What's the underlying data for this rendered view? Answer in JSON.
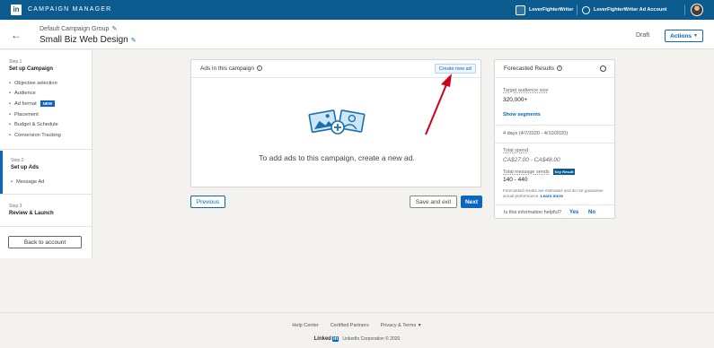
{
  "topbar": {
    "logo_text": "in",
    "app_title": "CAMPAIGN MANAGER",
    "account_name": "LoverFighterWriter",
    "ad_account_name": "LoverFighterWriter Ad Account"
  },
  "header": {
    "group_name": "Default Campaign Group",
    "campaign_name": "Small Biz Web Design",
    "status": "Draft",
    "actions_label": "Actions"
  },
  "sidebar": {
    "step1": {
      "label": "Step 1",
      "title": "Set up Campaign",
      "items": [
        {
          "label": "Objective selection"
        },
        {
          "label": "Audience"
        },
        {
          "label": "Ad format",
          "badge": "NEW"
        },
        {
          "label": "Placement"
        },
        {
          "label": "Budget & Schedule"
        },
        {
          "label": "Conversion Tracking"
        }
      ]
    },
    "step2": {
      "label": "Step 2",
      "title": "Set up Ads",
      "items": [
        {
          "label": "Message Ad"
        }
      ]
    },
    "step3": {
      "label": "Step 3",
      "title": "Review & Launch"
    },
    "back_button": "Back to account"
  },
  "ads_card": {
    "title": "Ads in this campaign",
    "create_label": "Create new ad",
    "empty_message": "To add ads to this campaign, create a new ad."
  },
  "buttons": {
    "previous": "Previous",
    "save_exit": "Save and exit",
    "next": "Next"
  },
  "forecast": {
    "title": "Forecasted Results",
    "audience_label": "Target audience size",
    "audience_value": "320,000+",
    "show_segments": "Show segments",
    "date_range": "4 days (4/7/2020 - 4/10/2020)",
    "spend_label": "Total spend",
    "spend_value": "CA$27.00 - CA$48.00",
    "sends_label": "Total message sends",
    "key_result_badge": "Key Result",
    "sends_value": "140 - 440",
    "note": "Forecasted results are estimates and do not guarantee actual performance.",
    "learn_more": "Learn more",
    "helpful_q": "Is this information helpful?",
    "yes": "Yes",
    "no": "No"
  },
  "footer": {
    "links": [
      "Help Center",
      "Certified Partners",
      "Privacy & Terms"
    ],
    "brand": "Linked",
    "brand_in": "in",
    "copyright": "LinkedIn Corporation © 2020"
  },
  "colors": {
    "brand_dark": "#0b5b8f",
    "accent": "#0a66c2",
    "annotation_arrow": "#d0021b"
  }
}
